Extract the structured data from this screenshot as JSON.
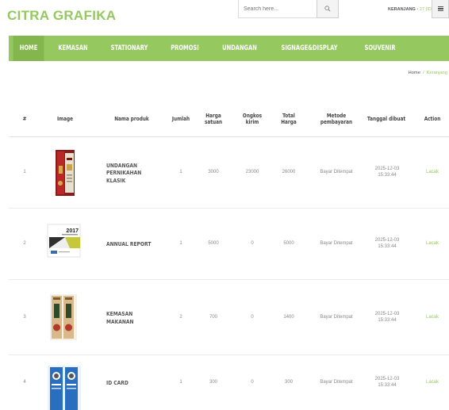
{
  "brand": {
    "name": "CITRA GRAFIKA"
  },
  "search": {
    "placeholder": "Search here...",
    "value": ""
  },
  "cart": {
    "label": "KERANJANG",
    "count": "• 27 (ID)"
  },
  "nav": [
    {
      "label": "HOME",
      "active": true
    },
    {
      "label": "KEMASAN",
      "active": false
    },
    {
      "label": "STATIONARY",
      "active": false
    },
    {
      "label": "PROMOSI",
      "active": false
    },
    {
      "label": "UNDANGAN",
      "active": false
    },
    {
      "label": "SIGNAGE&DISPLAY",
      "active": false
    },
    {
      "label": "SOUVENIR",
      "active": false
    }
  ],
  "breadcrumb": {
    "home": "Home",
    "separator": "/",
    "current": "Keranjang"
  },
  "table": {
    "headers": [
      "#",
      "Image",
      "Nama produk",
      "Jumlah",
      "Harga satuan",
      "Ongkos kirim",
      "Total Harga",
      "Metode pembayaran",
      "Tanggal dibuat",
      "Action"
    ],
    "rows": [
      {
        "no": "1",
        "image": "undangan-pernikahan-thumb",
        "name": "UNDANGAN PERNIKAHAN KLASIK",
        "qty": "1",
        "price": "3000",
        "shipping": "23000",
        "total": "26000",
        "payment": "Bayar Ditempat",
        "date": "2025-12-03 15:33:44",
        "action": "Lacak"
      },
      {
        "no": "2",
        "image": "annual-report-thumb",
        "name": "ANNUAL REPORT",
        "qty": "1",
        "price": "5000",
        "shipping": "0",
        "total": "5000",
        "payment": "Bayar Ditempat",
        "date": "2025-12-03 15:33:44",
        "action": "Lacak",
        "thumb_text": "2017"
      },
      {
        "no": "3",
        "image": "kemasan-makanan-thumb",
        "name": "KEMASAN MAKANAN",
        "qty": "2",
        "price": "700",
        "shipping": "0",
        "total": "1400",
        "payment": "Bayar Ditempat",
        "date": "2025-12-03 15:33:44",
        "action": "Lacak"
      },
      {
        "no": "4",
        "image": "id-card-thumb",
        "name": "ID CARD",
        "qty": "1",
        "price": "300",
        "shipping": "0",
        "total": "300",
        "payment": "Bayar Ditempat",
        "date": "2025-12-03 15:33:44",
        "action": "Lacak"
      }
    ]
  },
  "colors": {
    "accent": "#95c85e",
    "accent_dark": "#84b64e",
    "text": "#333333",
    "muted": "#888888"
  }
}
